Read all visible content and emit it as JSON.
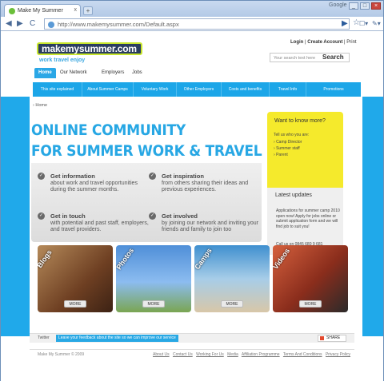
{
  "browser": {
    "tab_title": "Make My Summer",
    "tab_close": "x",
    "new_tab": "+",
    "google_label": "Google",
    "address_url": "http://www.makemysummer.com/Default.aspx",
    "address_domain": "www.makemysummer.com",
    "nav_back": "◀",
    "nav_forward": "▶",
    "nav_reload": "C",
    "nav_star": "☆",
    "nav_go": "▶",
    "nav_page": "☐▾",
    "nav_tools": "✎▾",
    "win_min": "_",
    "win_max": "□",
    "win_close": "×"
  },
  "site": {
    "logo_text": "makemysummer.com",
    "tagline": "work travel enjoy",
    "top_links": {
      "login": "Login",
      "sep1": "|",
      "create": "Create Account",
      "sep2": "|",
      "print": "Print"
    },
    "search_placeholder": "Your search text here",
    "search_button": "Search",
    "main_nav": [
      "Home",
      "Our Network",
      "Employers",
      "Jobs"
    ],
    "sub_nav": [
      "This site explained",
      "About Summer Camps",
      "Voluntary Work",
      "Other Employers",
      "Costs and benefits",
      "Travel Info",
      "Promotions"
    ],
    "breadcrumb": "Home",
    "hero_line1": "ONLINE COMMUNITY",
    "hero_line2": "FOR SUMMER WORK & TRAVEL",
    "features": [
      {
        "title": "Get information",
        "desc": "about work and travel opportunities during the summer months."
      },
      {
        "title": "Get inspiration",
        "desc": "from others sharing their ideas and previous experiences."
      },
      {
        "title": "Get in touch",
        "desc": "with potential and past staff, employers, and travel providers."
      },
      {
        "title": "Get involved",
        "desc": "by joining our network and inviting your friends and family to join too"
      }
    ],
    "feature_check": "✓",
    "want": {
      "title": "Want to know more?",
      "intro": "Tell us who you are:",
      "items": [
        "Camp Director",
        "Summer staff",
        "Parent"
      ]
    },
    "latest": {
      "title": "Latest updates",
      "text": "Applications for summer camp 2010 open now! Apply for jobs online or submit application form and we will find job to suit you!",
      "contact": "Call us on 0845 680 9 681"
    },
    "tiles": [
      {
        "label": "Blogs",
        "more": "MORE",
        "color": "#7a4a2a"
      },
      {
        "label": "Photos",
        "more": "MORE",
        "color": "#5a86c8"
      },
      {
        "label": "Camps",
        "more": "MORE",
        "color": "#3a8ac0"
      },
      {
        "label": "Videos",
        "more": "MORE",
        "color": "#8a3020"
      }
    ],
    "twitter_label": "Twitter",
    "feedback_text": "Leave your feedback about the site so we can improve our service",
    "share_label": "SHARE",
    "copyright": "Make My Summer © 2009",
    "footer_links": [
      "About Us",
      "Contact Us",
      "Working For Us",
      "Media",
      "Affiliation Programme",
      "Terms And Conditions",
      "Privacy Policy"
    ]
  }
}
